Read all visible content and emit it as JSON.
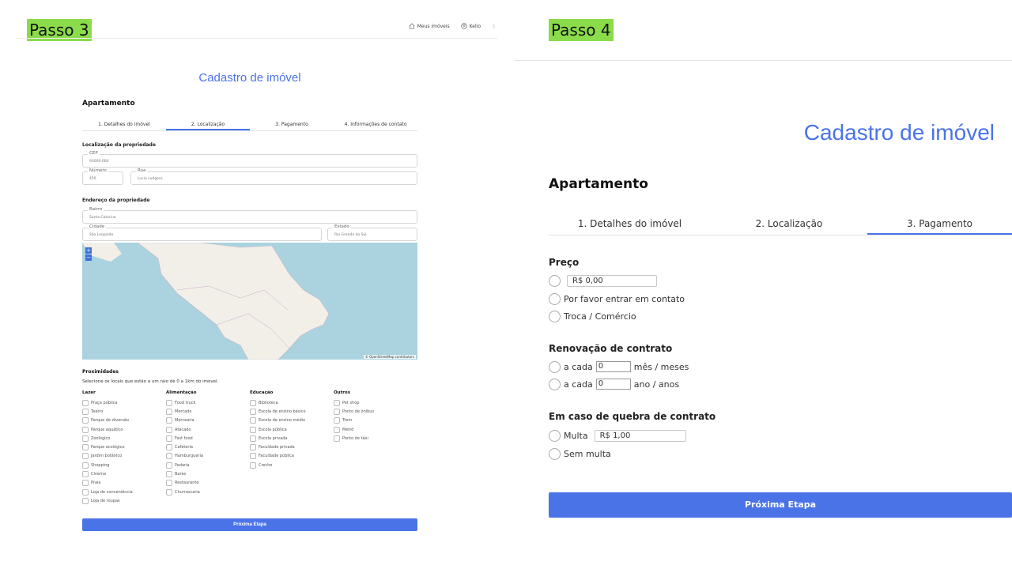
{
  "tags": {
    "step3": "Passo 3",
    "step4": "Passo 4"
  },
  "nav": {
    "my_properties": "Meus imóveis",
    "user": "Kelio",
    "more": "⋮"
  },
  "left": {
    "title": "Cadastro de imóvel",
    "heading": "Apartamento",
    "tabs": [
      "1. Detalhes do imóvel",
      "2. Localização",
      "3. Pagamento",
      "4. Informações de contato"
    ],
    "location_label": "Localização da propriedade",
    "cep": {
      "label": "CEP",
      "value": "93000-000"
    },
    "numero": {
      "label": "Número",
      "value": "456"
    },
    "rua": {
      "label": "Rua",
      "value": "Lucia Ludgero"
    },
    "address_label": "Endereço da propriedade",
    "bairro": {
      "label": "Bairro",
      "value": "Santa Catarina"
    },
    "cidade": {
      "label": "Cidade",
      "value": "São Leopoldo"
    },
    "estado": {
      "label": "Estado",
      "value": "Rio Grande do Sul"
    },
    "map": {
      "attribution": "© OpenStreetMap contributors",
      "zoom_in": "+",
      "zoom_out": "−"
    },
    "proximity_title": "Proximidades",
    "proximity_sub": "Selecione os locais que estão a um raio de 0 a 1km do imóvel.",
    "columns": [
      {
        "head": "Lazer",
        "items": [
          "Praça pública",
          "Teatro",
          "Parque de diversão",
          "Parque aquático",
          "Zoológico",
          "Parque ecológico",
          "Jardim botânico",
          "Shopping",
          "Cinema",
          "Praia",
          "Loja de conveniência",
          "Loja de roupas"
        ]
      },
      {
        "head": "Alimentação",
        "items": [
          "Food truck",
          "Mercado",
          "Mercearia",
          "Atacado",
          "Fast food",
          "Cafeteria",
          "Hamburgueria",
          "Padaria",
          "Bares",
          "Restaurante",
          "Churrascaria"
        ]
      },
      {
        "head": "Educação",
        "items": [
          "Biblioteca",
          "Escola de ensino básico",
          "Escola de ensino médio",
          "Escola pública",
          "Escola privada",
          "Faculdade privada",
          "Faculdade pública",
          "Creche"
        ]
      },
      {
        "head": "Outros",
        "items": [
          "Pet shop",
          "Ponto de ônibus",
          "Trem",
          "Metrô",
          "Ponto de táxi"
        ]
      }
    ],
    "next_button": "Próxima Etapa"
  },
  "right": {
    "title": "Cadastro de imóvel",
    "heading": "Apartamento",
    "tabs": [
      "1. Detalhes do imóvel",
      "2. Localização",
      "3. Pagamento"
    ],
    "price_label": "Preço",
    "price_value": "R$ 0,00",
    "contact_option": "Por favor entrar em contato",
    "trade_option": "Troca / Comércio",
    "renewal_label": "Renovação de contrato",
    "every": "a cada",
    "months_value": "0",
    "months_unit": "mês / meses",
    "years_value": "0",
    "years_unit": "ano / anos",
    "breach_label": "Em caso de quebra de contrato",
    "fine_option": "Multa",
    "fine_value": "R$ 1,00",
    "no_fine_option": "Sem multa",
    "next_button": "Próxima Etapa"
  }
}
